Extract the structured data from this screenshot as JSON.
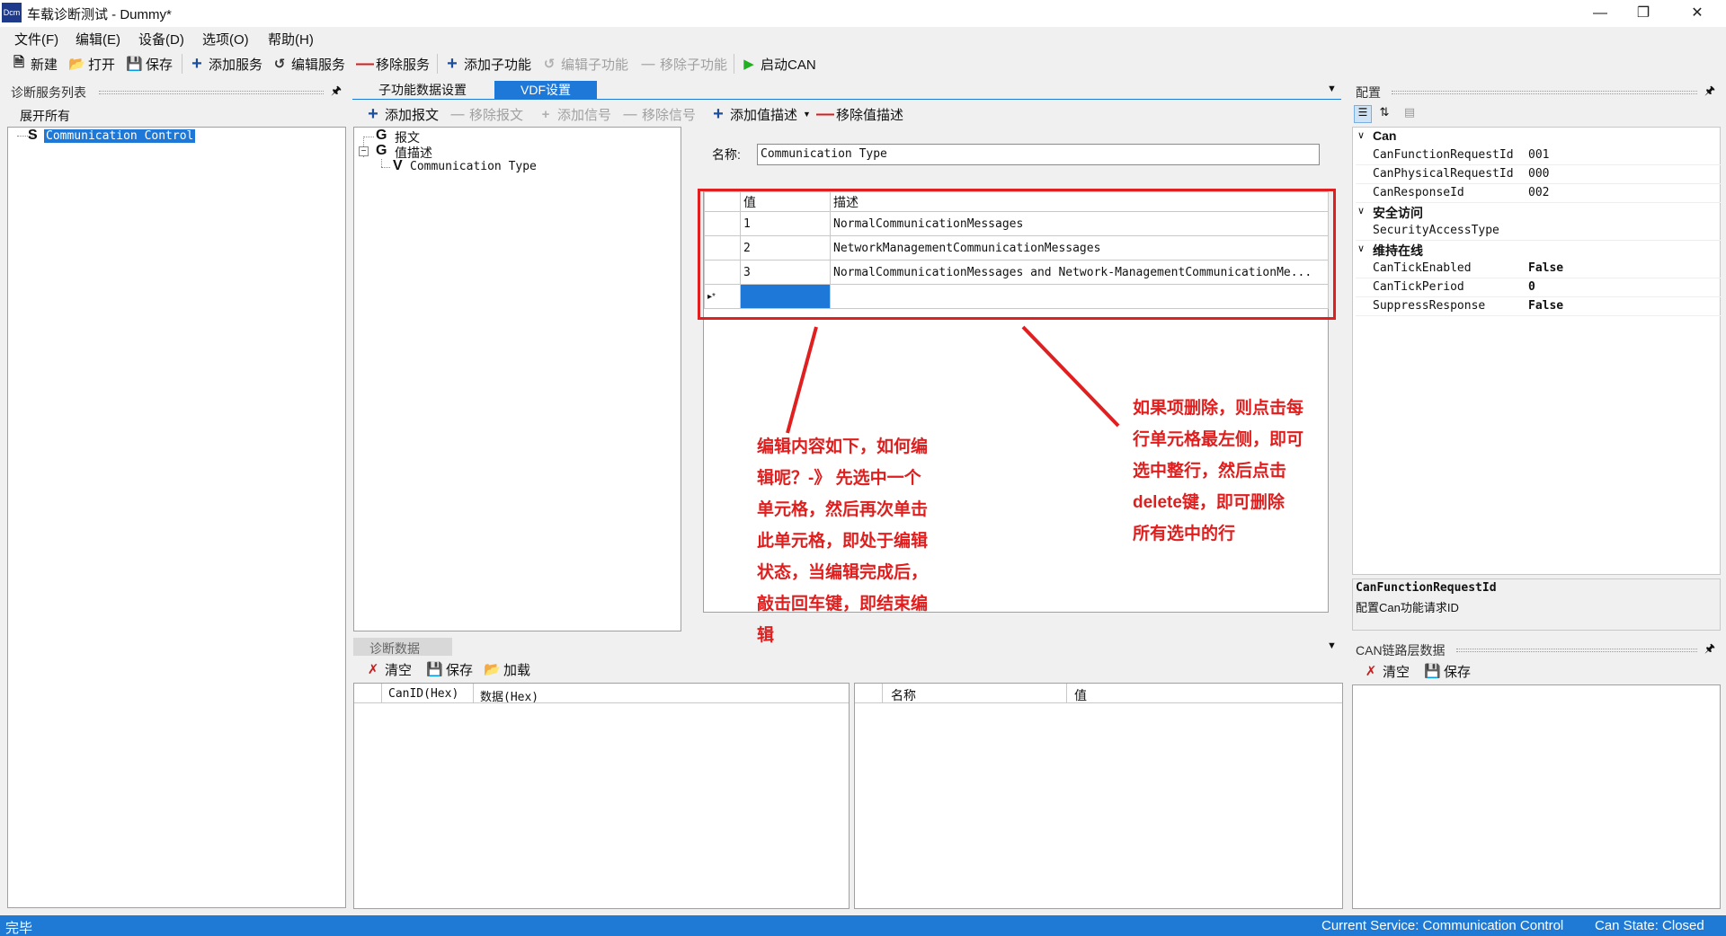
{
  "window": {
    "title": "车载诊断测试 - Dummy*",
    "app_icon": "Dcm"
  },
  "menu": [
    "文件(F)",
    "编辑(E)",
    "设备(D)",
    "选项(O)",
    "帮助(H)"
  ],
  "toolbar": {
    "new": "新建",
    "open": "打开",
    "save": "保存",
    "add_service": "添加服务",
    "edit_service": "编辑服务",
    "remove_service": "移除服务",
    "add_sub": "添加子功能",
    "edit_sub": "编辑子功能",
    "remove_sub": "移除子功能",
    "start_can": "启动CAN"
  },
  "left_panel": {
    "title": "诊断服务列表",
    "expand_all": "展开所有",
    "tree_prefix": "S",
    "tree_item": "Communication Control"
  },
  "tabs": [
    "子功能数据设置",
    "VDF设置"
  ],
  "vdf_toolbar": {
    "add_msg": "添加报文",
    "remove_msg": "移除报文",
    "add_signal": "添加信号",
    "remove_signal": "移除信号",
    "add_value_desc": "添加值描述",
    "remove_value_desc": "移除值描述"
  },
  "vdf_tree": [
    {
      "prefix": "G",
      "label": "报文"
    },
    {
      "prefix": "G",
      "label": "值描述"
    },
    {
      "prefix": "V",
      "label": "Communication Type"
    }
  ],
  "name_field": {
    "label": "名称:",
    "value": "Communication Type"
  },
  "value_grid": {
    "headers": [
      "值",
      "描述"
    ],
    "rows": [
      [
        "1",
        "NormalCommunicationMessages"
      ],
      [
        "2",
        "NetworkManagementCommunicationMessages"
      ],
      [
        "3",
        "NormalCommunicationMessages and Network-ManagementCommunicationMe..."
      ]
    ],
    "new_row_marker": "▸*"
  },
  "annotations": {
    "left": [
      "编辑内容如下，如何编",
      "辑呢？-》 先选中一个",
      "单元格，然后再次单击",
      "此单元格，即处于编辑",
      "状态，当编辑完成后，",
      "敲击回车键，即结束编",
      "辑"
    ],
    "right": [
      "如果项删除，则点击每",
      "行单元格最左侧，即可",
      "选中整行，然后点击",
      "delete键，即可删除",
      "所有选中的行"
    ]
  },
  "config_panel": {
    "title": "配置",
    "categories": [
      {
        "name": "Can",
        "props": [
          [
            "CanFunctionRequestId",
            "001"
          ],
          [
            "CanPhysicalRequestId",
            "000"
          ],
          [
            "CanResponseId",
            "002"
          ]
        ]
      },
      {
        "name": "安全访问",
        "props": [
          [
            "SecurityAccessType",
            ""
          ]
        ]
      },
      {
        "name": "维持在线",
        "props": [
          [
            "CanTickEnabled",
            "False"
          ],
          [
            "CanTickPeriod",
            "0"
          ],
          [
            "SuppressResponse",
            "False"
          ]
        ]
      }
    ],
    "desc_title": "CanFunctionRequestId",
    "desc_text": "配置Can功能请求ID"
  },
  "diag_panel": {
    "title": "诊断数据",
    "clear": "清空",
    "save": "保存",
    "load": "加载",
    "left_headers": [
      "CanID(Hex)",
      "数据(Hex)"
    ],
    "right_headers": [
      "名称",
      "值"
    ]
  },
  "can_panel": {
    "title": "CAN链路层数据",
    "clear": "清空",
    "save": "保存"
  },
  "status": {
    "left": "完毕",
    "service": "Current Service: Communication Control",
    "can_state": "Can State: Closed"
  },
  "colors": {
    "accent": "#1e78d7",
    "annotation": "#e01e1e",
    "run": "#22b022"
  }
}
